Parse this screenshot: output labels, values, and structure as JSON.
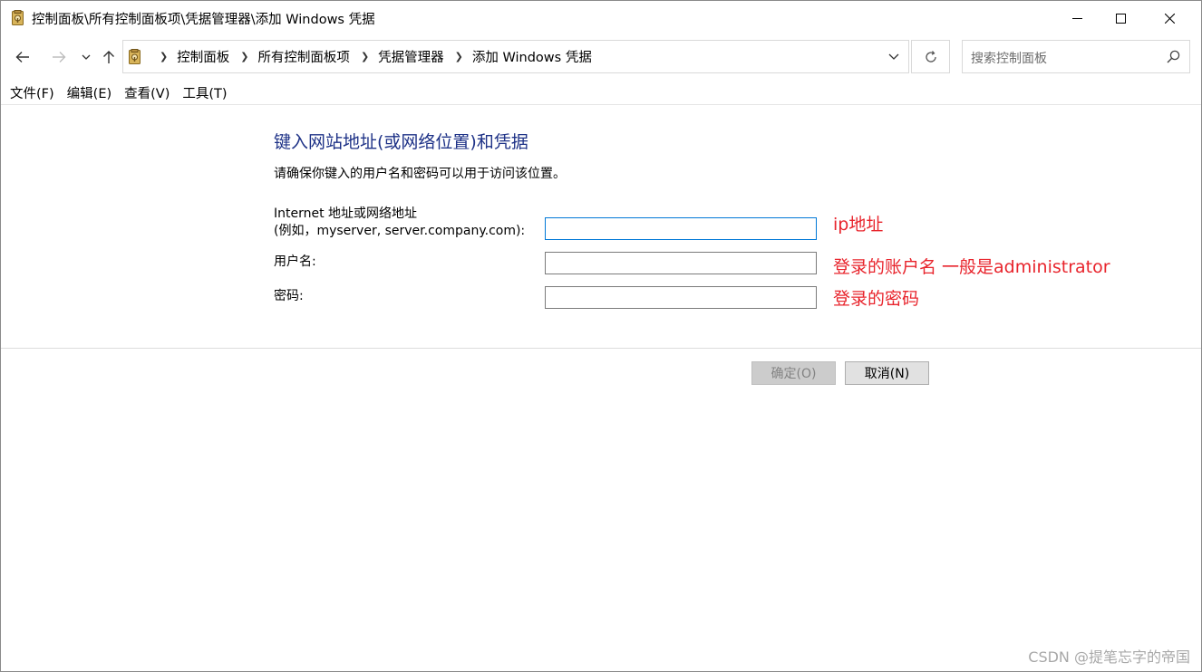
{
  "window": {
    "title": "控制面板\\所有控制面板项\\凭据管理器\\添加 Windows 凭据",
    "icon": "credential-manager-icon"
  },
  "address_bar": {
    "breadcrumbs": [
      "控制面板",
      "所有控制面板项",
      "凭据管理器",
      "添加 Windows 凭据"
    ]
  },
  "search": {
    "placeholder": "搜索控制面板"
  },
  "menu": [
    "文件(F)",
    "编辑(E)",
    "查看(V)",
    "工具(T)"
  ],
  "form": {
    "heading": "键入网站地址(或网络位置)和凭据",
    "description": "请确保你键入的用户名和密码可以用于访问该位置。",
    "address_label_line1": "Internet 地址或网络地址",
    "address_label_line2": "(例如，myserver, server.company.com):",
    "username_label": "用户名:",
    "password_label": "密码:",
    "address_value": "",
    "username_value": "",
    "password_value": ""
  },
  "annotations": {
    "address": "ip地址",
    "username": "登录的账户名 一般是administrator",
    "password": "登录的密码",
    "color": "#e8242c"
  },
  "buttons": {
    "ok": "确定(O)",
    "cancel": "取消(N)"
  },
  "watermark": "CSDN @提笔忘字的帝国",
  "colors": {
    "heading": "#1e3287",
    "focus_border": "#0078d7"
  }
}
